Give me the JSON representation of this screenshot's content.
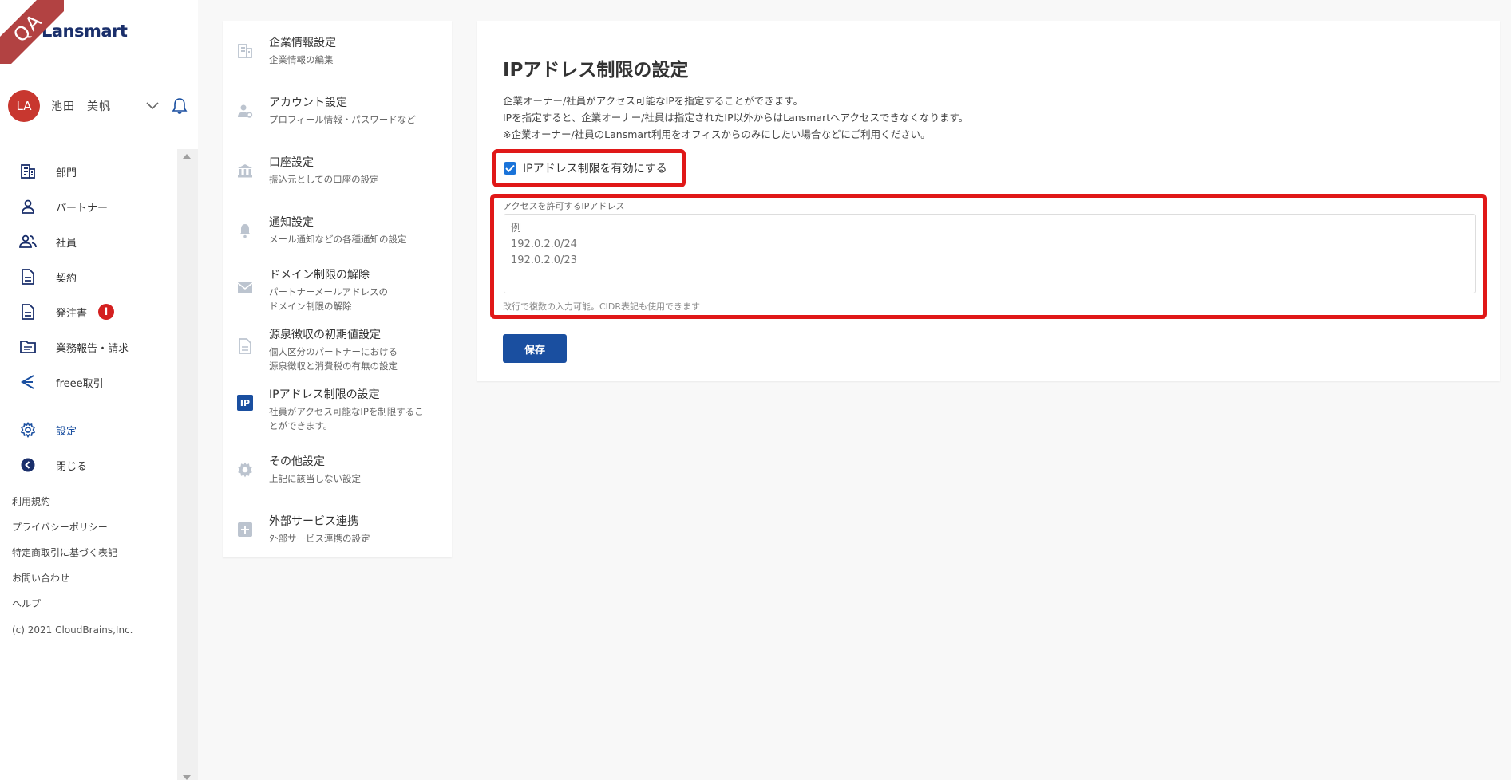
{
  "ribbon": {
    "text": "QA"
  },
  "brand": {
    "name": "Lansmart",
    "color": "#1a2f6b"
  },
  "user": {
    "initials": "LA",
    "name": "池田　美帆",
    "avatar_color": "#c8372f"
  },
  "nav": {
    "items": [
      {
        "id": "department",
        "label": "部門",
        "icon": "building-icon"
      },
      {
        "id": "partner",
        "label": "パートナー",
        "icon": "person-icon"
      },
      {
        "id": "employee",
        "label": "社員",
        "icon": "people-icon"
      },
      {
        "id": "contract",
        "label": "契約",
        "icon": "document-icon"
      },
      {
        "id": "order",
        "label": "発注書",
        "icon": "document-icon",
        "badge": "i"
      },
      {
        "id": "report",
        "label": "業務報告・請求",
        "icon": "folder-icon"
      },
      {
        "id": "freee",
        "label": "freee取引",
        "icon": "freee-icon"
      }
    ],
    "settings_label": "設定",
    "close_label": "閉じる"
  },
  "footer": {
    "links": [
      "利用規約",
      "プライバシーポリシー",
      "特定商取引に基づく表記",
      "お問い合わせ",
      "ヘルプ"
    ],
    "copyright": "(c) 2021 CloudBrains,Inc."
  },
  "settings_menu": {
    "items": [
      {
        "title": "企業情報設定",
        "sub": "企業情報の編集",
        "icon": "building-icon"
      },
      {
        "title": "アカウント設定",
        "sub": "プロフィール情報・パスワードなど",
        "icon": "user-gear-icon"
      },
      {
        "title": "口座設定",
        "sub": "振込元としての口座の設定",
        "icon": "bank-icon"
      },
      {
        "title": "通知設定",
        "sub": "メール通知などの各種通知の設定",
        "icon": "bell-icon"
      },
      {
        "title": "ドメイン制限の解除",
        "sub1": "パートナーメールアドレスの",
        "sub2": "ドメイン制限の解除",
        "icon": "mail-icon"
      },
      {
        "title": "源泉徴収の初期値設定",
        "sub1": "個人区分のパートナーにおける",
        "sub2": "源泉徴収と消費税の有無の設定",
        "icon": "document-icon"
      },
      {
        "title": "IPアドレス制限の設定",
        "sub1": "社員がアクセス可能なIPを制限するこ",
        "sub2": "とができます。",
        "icon": "ip-icon",
        "icon_text": "IP"
      },
      {
        "title": "その他設定",
        "sub": "上記に該当しない設定",
        "icon": "gear-icon"
      },
      {
        "title": "外部サービス連携",
        "sub": "外部サービス連携の設定",
        "icon": "plus-box-icon"
      }
    ]
  },
  "main": {
    "title": "IPアドレス制限の設定",
    "desc1": "企業オーナー/社員がアクセス可能なIPを指定することができます。",
    "desc2": "IPを指定すると、企業オーナー/社員は指定されたIP以外からはLansmartへアクセスできなくなります。",
    "desc3": "※企業オーナー/社員のLansmart利用をオフィスからのみにしたい場合などにご利用ください。",
    "checkbox_label": "IPアドレス制限を有効にする",
    "checkbox_checked": true,
    "field_label": "アクセスを許可するIPアドレス",
    "field_placeholder": "例\n192.0.2.0/24\n192.0.2.0/23",
    "field_hint": "改行で複数の入力可能。CIDR表記も使用できます",
    "save_label": "保存"
  },
  "colors": {
    "primary": "#1a4fa0",
    "highlight": "#e01818",
    "badge": "#d42020"
  }
}
